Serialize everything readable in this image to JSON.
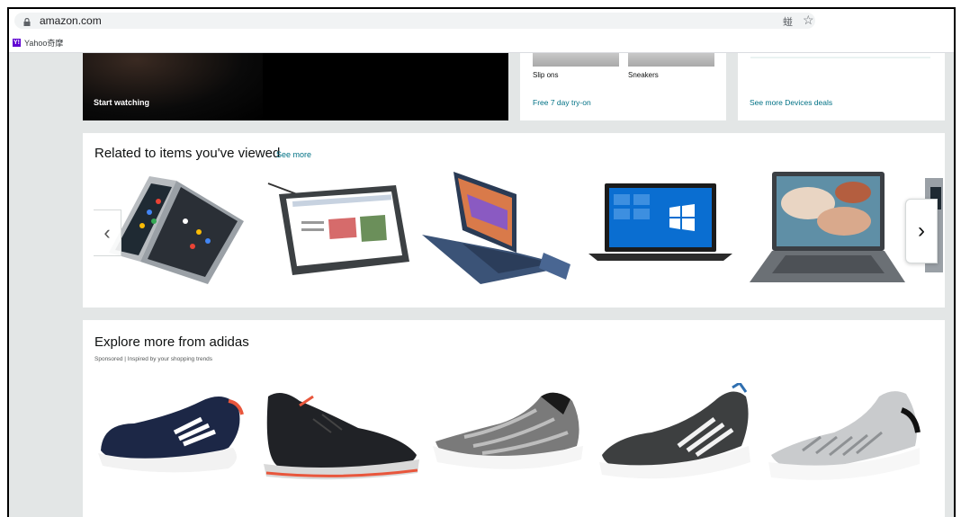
{
  "browser": {
    "url": "amazon.com",
    "translate_icon": "䗒",
    "star_icon": "☆",
    "bookmark_favicon": "Y!",
    "bookmark_label": "Yahoo奇摩"
  },
  "top_row": {
    "video_card": {
      "cta": "Start watching"
    },
    "shoes_card": {
      "captions": [
        "Slip ons",
        "Sneakers"
      ],
      "link": "Free 7 day try-on"
    },
    "devices_card": {
      "link": "See more Devices deals"
    }
  },
  "related": {
    "title": "Related to items you've viewed",
    "see_more": "See more",
    "prev_arrow": "‹",
    "next_arrow": "›"
  },
  "adidas": {
    "title": "Explore more from adidas",
    "subtitle": "Sponsored | Inspired by your shopping trends"
  },
  "colors": {
    "link": "#007185",
    "page_bg": "#e3e6e6",
    "text": "#0f1111"
  }
}
